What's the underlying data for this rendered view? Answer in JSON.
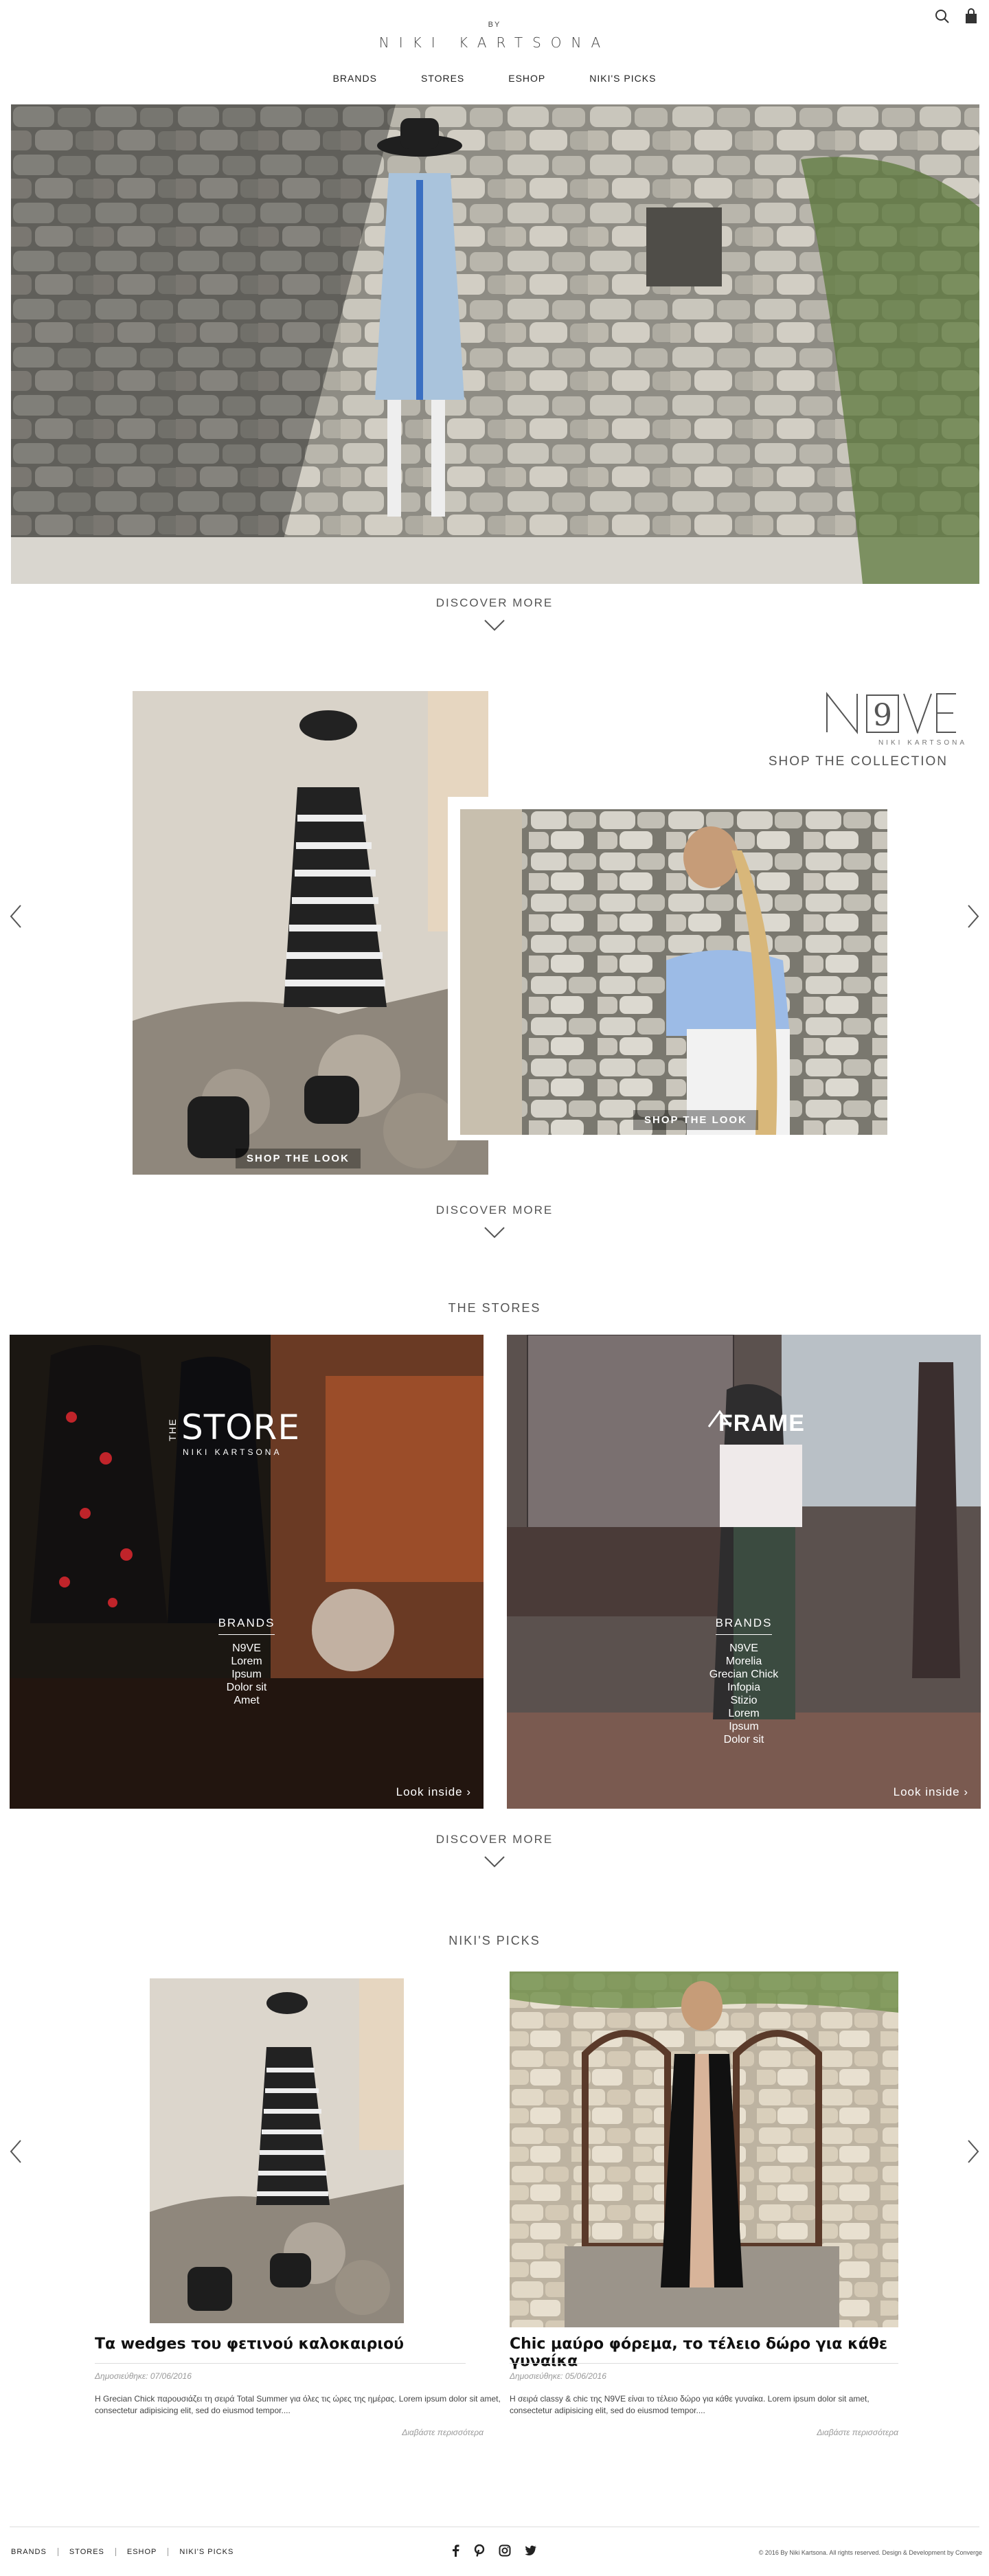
{
  "header": {
    "logo_by": "BY",
    "logo_name": "NIKI KARTSONA",
    "nav": [
      "BRANDS",
      "STORES",
      "ESHOP",
      "NIKI'S PICKS"
    ]
  },
  "icons": {
    "search": "search-icon",
    "bag": "shopping-bag-icon"
  },
  "hero": {
    "discover": "DISCOVER MORE"
  },
  "collection": {
    "logo": "N9VE",
    "logo_sub": "NIKI KARTSONA",
    "shop_collection": "SHOP THE COLLECTION",
    "shop_look_1": "SHOP THE LOOK",
    "shop_look_2": "SHOP THE LOOK",
    "discover": "DISCOVER MORE"
  },
  "stores": {
    "title": "THE STORES",
    "store1": {
      "logo_the": "THE",
      "logo_store": "STORE",
      "logo_sub": "NIKI KARTSONA",
      "brands_heading": "BRANDS",
      "brands": [
        "N9VE",
        "Lorem",
        "Ipsum",
        "Dolor sit",
        "Amet"
      ],
      "look_inside": "Look inside ›"
    },
    "store2": {
      "logo": "FRAME",
      "brands_heading": "BRANDS",
      "brands": [
        "N9VE",
        "Morelia",
        "Grecian Chick",
        "Infopia",
        "Stizio",
        "Lorem",
        "Ipsum",
        "Dolor sit"
      ],
      "look_inside": "Look inside ›"
    },
    "discover": "DISCOVER MORE"
  },
  "picks": {
    "title": "NIKI'S PICKS",
    "items": [
      {
        "title": "Τα wedges του φετινού καλοκαιριού",
        "date": "Δημοσιεύθηκε: 07/06/2016",
        "text": "H Grecian Chick παρουσιάζει τη σειρά Total Summer για όλες τις ώρες της ημέρας. Lorem ipsum dolor sit amet, consectetur adipisicing elit, sed do eiusmod tempor....",
        "more": "Διαβάστε περισσότερα"
      },
      {
        "title": "Chic μαύρο φόρεμα, το τέλειο δώρο για κάθε γυναίκα",
        "date": "Δημοσιεύθηκε: 05/06/2016",
        "text": "H σειρά classy & chic της N9VE είναι το τέλειο δώρο για κάθε γυναίκα. Lorem ipsum dolor sit amet, consectetur adipisicing elit, sed do eiusmod tempor....",
        "more": "Διαβάστε περισσότερα"
      }
    ]
  },
  "footer": {
    "nav": [
      "BRANDS",
      "STORES",
      "ESHOP",
      "NIKI'S PICKS"
    ],
    "social": [
      "facebook-icon",
      "pinterest-icon",
      "instagram-icon",
      "twitter-icon"
    ],
    "copyright": "© 2016 By Niki Kartsona. All rights reserved. Design & Development by Converge"
  }
}
